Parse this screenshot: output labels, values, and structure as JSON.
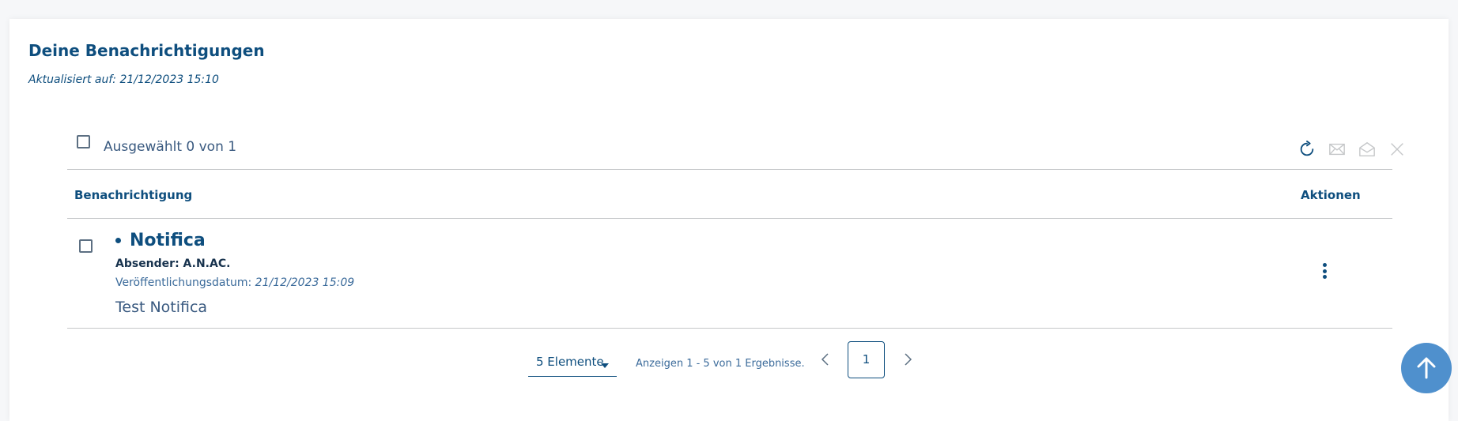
{
  "header": {
    "title": "Deine Benachrichtigungen",
    "updated": "Aktualisiert auf: 21/12/2023 15:10"
  },
  "toolbar": {
    "selected_label": "Ausgewählt 0 von 1",
    "icons": [
      "refresh-icon",
      "mark-unread-icon",
      "mark-read-icon",
      "close-icon"
    ]
  },
  "table": {
    "columns": [
      "Benachrichtigung",
      "Aktionen"
    ],
    "rows": [
      {
        "title": "Notifica",
        "sender": "Absender: A.N.AC.",
        "date_label": "Veröffentlichungsdatum:",
        "date_value": "21/12/2023 15:09",
        "message": "Test Notifica",
        "unread": true
      }
    ]
  },
  "pagination": {
    "page_size": "5 Elemente",
    "results": "Anzeigen 1 - 5 von 1 Ergebnisse.",
    "current_page": "1"
  },
  "colors": {
    "primary": "#0e4e7e",
    "back_to_top": "#4f90cd",
    "disabled_icon": "#c5c7c9"
  }
}
